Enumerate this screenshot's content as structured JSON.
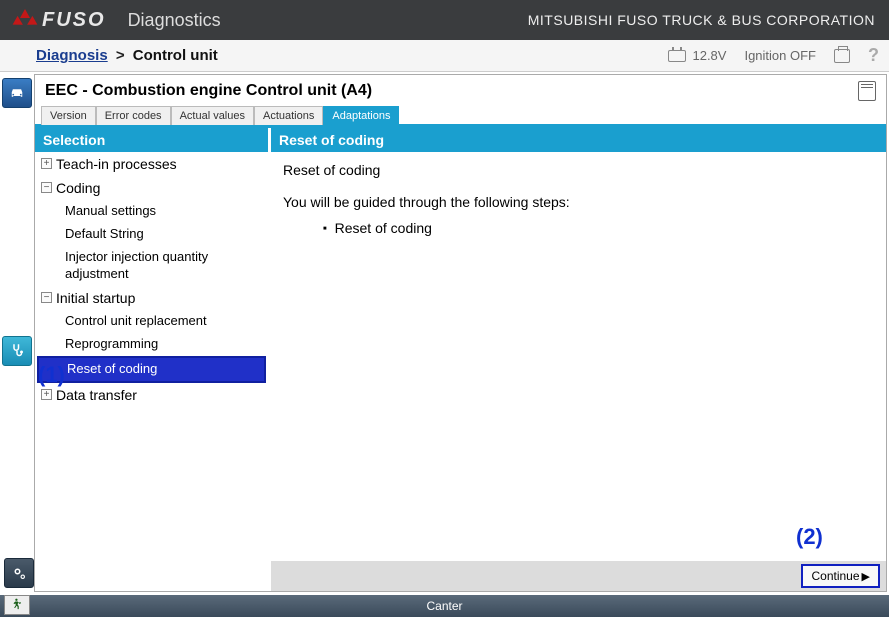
{
  "header": {
    "brand": "FUSO",
    "app_name": "Diagnostics",
    "corp": "MITSUBISHI FUSO TRUCK & BUS CORPORATION"
  },
  "toolbar": {
    "breadcrumb_root": "Diagnosis",
    "breadcrumb_sep": ">",
    "breadcrumb_current": "Control unit",
    "voltage": "12.8V",
    "ignition": "Ignition OFF",
    "help": "?"
  },
  "content": {
    "title": "EEC - Combustion engine Control unit (A4)",
    "tabs": [
      {
        "label": "Version"
      },
      {
        "label": "Error codes"
      },
      {
        "label": "Actual values"
      },
      {
        "label": "Actuations"
      },
      {
        "label": "Adaptations"
      }
    ],
    "active_tab": 4
  },
  "selection": {
    "header": "Selection",
    "tree": [
      {
        "exp": "+",
        "label": "Teach-in processes",
        "level": 0
      },
      {
        "exp": "−",
        "label": "Coding",
        "level": 0
      },
      {
        "label": "Manual settings",
        "level": 1
      },
      {
        "label": "Default String",
        "level": 1
      },
      {
        "label": "Injector injection quantity adjustment",
        "level": 1
      },
      {
        "exp": "−",
        "label": "Initial startup",
        "level": 0
      },
      {
        "label": "Control unit replacement",
        "level": 1
      },
      {
        "label": "Reprogramming",
        "level": 1
      },
      {
        "label": "Reset of coding",
        "level": 1,
        "selected": true
      },
      {
        "exp": "+",
        "label": "Data transfer",
        "level": 0
      }
    ]
  },
  "detail": {
    "header": "Reset of coding",
    "heading": "Reset of coding",
    "intro": "You will be guided through the following steps:",
    "steps": [
      "Reset of coding"
    ],
    "continue": "Continue"
  },
  "footer": {
    "vehicle": "Canter"
  },
  "annotations": {
    "a1": "(1)",
    "a2": "(2)"
  }
}
